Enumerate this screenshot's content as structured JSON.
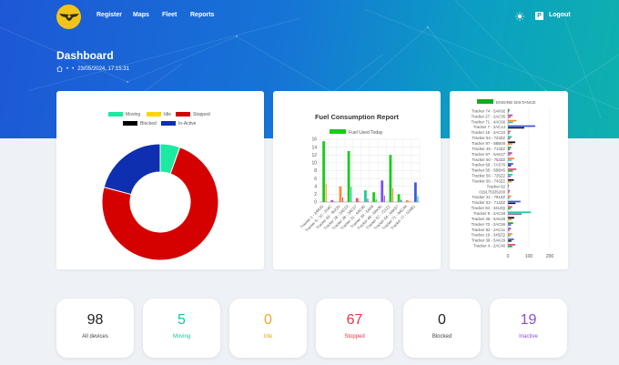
{
  "nav": {
    "links": [
      {
        "label": "Register"
      },
      {
        "label": "Maps"
      },
      {
        "label": "Fleet"
      },
      {
        "label": "Reports"
      }
    ],
    "logout_label": "Logout"
  },
  "page": {
    "title": "Dashboard",
    "timestamp": "23/05/2024, 17:15:31",
    "bg_colors": [
      "#1d57d6",
      "#0fb1ad"
    ]
  },
  "status_chart": {
    "legend": [
      {
        "label": "Moving",
        "color": "#1de9a0"
      },
      {
        "label": "Idle",
        "color": "#ffd600"
      },
      {
        "label": "Stopped",
        "color": "#d50000"
      },
      {
        "label": "Blocked",
        "color": "#000000"
      },
      {
        "label": "In-Active",
        "color": "#0d2fb0"
      }
    ]
  },
  "fuel_chart": {
    "title": "Fuel Consumption Report",
    "legend": "Fuel Used Today",
    "y_ticks": [
      "16",
      "14",
      "12",
      "10",
      "8",
      "6",
      "4",
      "2",
      "0"
    ]
  },
  "distance_chart": {
    "legend": "ENGINE DISTANCE",
    "x_ticks": [
      "0",
      "100",
      "200"
    ]
  },
  "chart_data": [
    {
      "type": "pie",
      "variant": "doughnut",
      "categories": [
        "Moving",
        "Idle",
        "Stopped",
        "Blocked",
        "In-Active"
      ],
      "values": [
        5,
        0,
        67,
        0,
        19
      ],
      "colors": [
        "#1de9a0",
        "#ffd600",
        "#d50000",
        "#000000",
        "#0d2fb0"
      ],
      "legend_position": "top"
    },
    {
      "type": "bar",
      "title": "Fuel Consumption Report",
      "categories": [
        "Tracker 1 - 3AR20",
        "Tracker 6 - 10 - 204C",
        "Tracker 60 - 90Z20",
        "Tracker 18 - 2AC03",
        "Tracker 28 - 3AC07",
        "Tracker 31 - 4AC40",
        "Tracker 39 - 5AK8",
        "Tracker 48 - 6AK90",
        "Tracker 57 - 721ZZ",
        "Tracker 64 - 8AK67",
        "Tracker 71 - 9AC44",
        "Tracker 77 - 10AB1"
      ],
      "series": [
        {
          "name": "Fuel Used Today",
          "values": [
            15.5,
            0.5,
            4,
            13,
            1,
            3,
            2.5,
            5.5,
            12,
            2,
            0.5,
            5
          ]
        }
      ],
      "ylim": [
        0,
        16
      ],
      "grid": true,
      "legend_position": "top"
    },
    {
      "type": "bar",
      "orientation": "horizontal",
      "categories": [
        "Tracker 74 - 5AK92",
        "Tracker 27 - 2AC35",
        "Tracker 71 - 4AC66",
        "Tracker 7 - 2AC14",
        "Tracker 16 - 2AC10",
        "Tracker 54 - 723ZZ",
        "Tracker 97 - 5BB48",
        "Tracker 45 - 713ZZ",
        "Tracker 57 - 5AK27",
        "Tracker 50 - 753ZZ",
        "Tracker 69 - 7AS76",
        "Tracker 55 - 5BB45",
        "Tracker 56 - 725ZZ",
        "Tracker 66 - 743ZZ",
        "Tracker 62",
        "019175335200",
        "Tracker 21 - 781ZZ",
        "Tracker 53 - 714ZZ",
        "Tracker 84 - 341ZQ",
        "Tracker 8 - 2AC48",
        "Tracker 36 - 5AK28",
        "Tracker 70 - 2AC56",
        "Tracker 82 - 2AC11",
        "Tracker 19 - 345ZQ",
        "Tracker 39 - 5AK29",
        "Tracker 4 - 2AC46"
      ],
      "series": [
        {
          "name": "ENGINE DISTANCE",
          "values": [
            8,
            22,
            40,
            130,
            12,
            18,
            35,
            15,
            20,
            30,
            25,
            40,
            22,
            28,
            5,
            10,
            15,
            60,
            20,
            110,
            30,
            25,
            15,
            20,
            28,
            35
          ]
        }
      ],
      "xlim": [
        0,
        200
      ],
      "legend_position": "top"
    }
  ],
  "stats": [
    {
      "value": "98",
      "label": "All devices",
      "color": "#222222"
    },
    {
      "value": "5",
      "label": "Moving",
      "color": "#19c2a6"
    },
    {
      "value": "0",
      "label": "Idle",
      "color": "#f5a623"
    },
    {
      "value": "67",
      "label": "Stopped",
      "color": "#e8334a"
    },
    {
      "value": "0",
      "label": "Blocked",
      "color": "#222222"
    },
    {
      "value": "19",
      "label": "Inactive",
      "color": "#8a4cd8"
    }
  ]
}
